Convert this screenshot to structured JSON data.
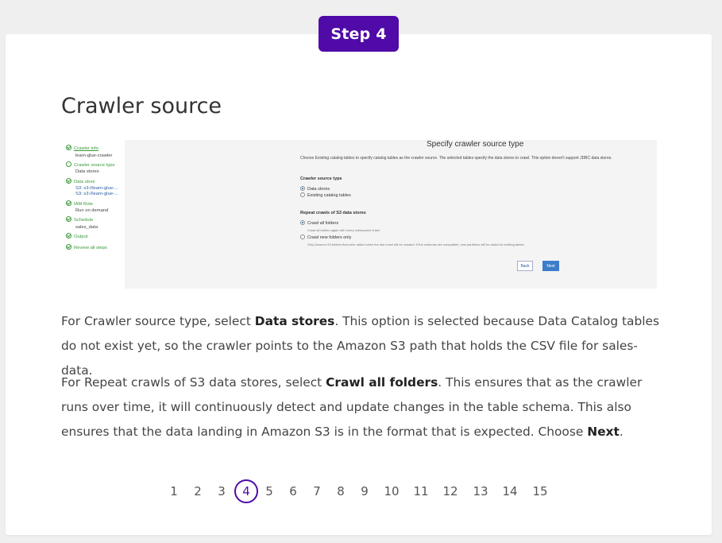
{
  "step_badge": "Step 4",
  "title": "Crawler source",
  "screenshot": {
    "nav": [
      {
        "label": "Crawler info",
        "kind": "step",
        "icon": "check-circle-icon"
      },
      {
        "label": "learn-glue-crawler",
        "kind": "sub"
      },
      {
        "label": "Crawler source type",
        "kind": "step",
        "icon": "circle-icon"
      },
      {
        "label": "Data stores",
        "kind": "sub"
      },
      {
        "label": "Data store",
        "kind": "step",
        "icon": "check-circle-icon"
      },
      {
        "label": "S3: s3://learn-glue-...",
        "kind": "sublink"
      },
      {
        "label": "S3: s3://learn-glue-...",
        "kind": "sublink"
      },
      {
        "label": "IAM Role",
        "kind": "step",
        "icon": "check-circle-icon"
      },
      {
        "label": "Run on demand",
        "kind": "sub"
      },
      {
        "label": "Schedule",
        "kind": "step",
        "icon": "check-circle-icon"
      },
      {
        "label": "sales_data",
        "kind": "sub"
      },
      {
        "label": "Output",
        "kind": "step",
        "icon": "check-circle-icon"
      },
      {
        "label": "Review all steps",
        "kind": "step",
        "icon": "check-circle-icon"
      }
    ],
    "main_title": "Specify crawler source type",
    "description": "Choose Existing catalog tables to specify catalog tables as the crawler source. The selected tables specify the data stores to crawl. This option doesn't support JDBC data stores.",
    "source_type_heading": "Crawler source type",
    "source_options": [
      {
        "label": "Data stores",
        "selected": true
      },
      {
        "label": "Existing catalog tables",
        "selected": false
      }
    ],
    "repeat_heading": "Repeat crawls of S3 data stores",
    "repeat_options": [
      {
        "label": "Crawl all folders",
        "selected": true,
        "help": "Crawl all folders again with every subsequent crawl."
      },
      {
        "label": "Crawl new folders only",
        "selected": false,
        "help": "Only Amazon S3 folders that were added since the last crawl will be crawled. If the schemas are compatible, new partitions will be added to existing tables."
      }
    ],
    "back_label": "Back",
    "next_label": "Next"
  },
  "paragraph1": {
    "a": "For Crawler source type, select ",
    "b": "Data stores",
    "c": ". This option is selected because Data Catalog tables do not exist yet, so the crawler points to the Amazon S3 path that holds the CSV file for sales-data."
  },
  "paragraph2": {
    "a": "For Repeat crawls of S3 data stores, select ",
    "b": "Crawl all folders",
    "c": ". This ensures that as the crawler runs over time, it will continuously detect and update changes in the table schema. This also ensures that the data landing in Amazon S3 is in the format that is expected. Choose ",
    "d": "Next",
    "e": "."
  },
  "pagination": {
    "pages": [
      "1",
      "2",
      "3",
      "4",
      "5",
      "6",
      "7",
      "8",
      "9",
      "10",
      "11",
      "12",
      "13",
      "14",
      "15"
    ],
    "active": "4"
  },
  "colors": {
    "accent": "#4f0aa8",
    "check_green": "#3a9a3a",
    "next_blue": "#3d7cc9"
  }
}
